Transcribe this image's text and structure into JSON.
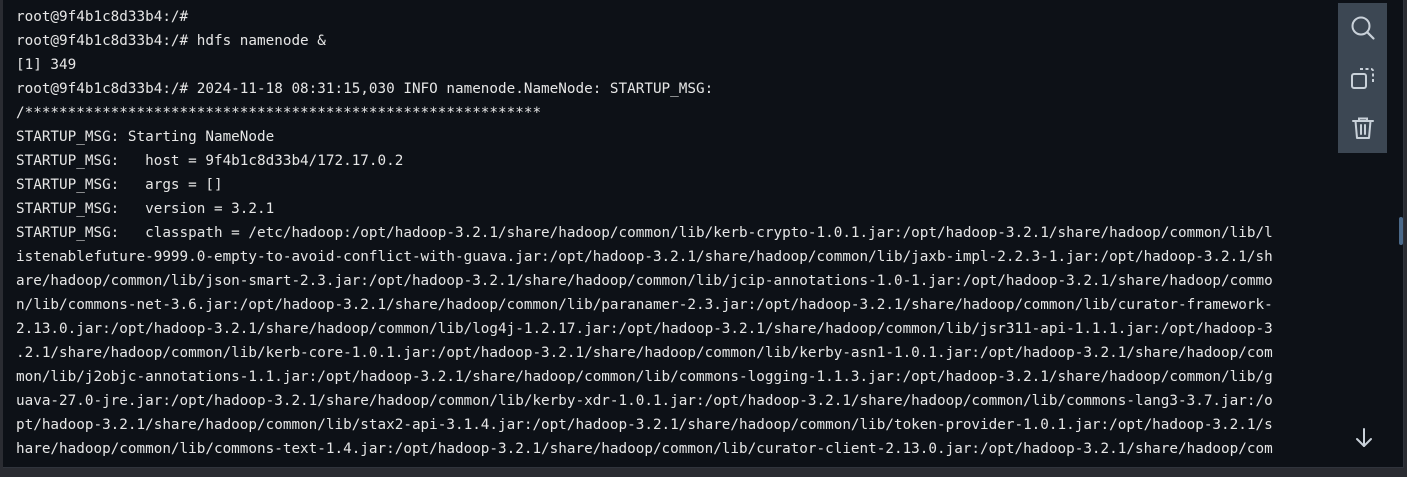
{
  "terminal": {
    "lines": [
      "root@9f4b1c8d33b4:/#",
      "root@9f4b1c8d33b4:/# hdfs namenode &",
      "[1] 349",
      "root@9f4b1c8d33b4:/# 2024-11-18 08:31:15,030 INFO namenode.NameNode: STARTUP_MSG:",
      "/************************************************************",
      "STARTUP_MSG: Starting NameNode",
      "STARTUP_MSG:   host = 9f4b1c8d33b4/172.17.0.2",
      "STARTUP_MSG:   args = []",
      "STARTUP_MSG:   version = 3.2.1",
      "STARTUP_MSG:   classpath = /etc/hadoop:/opt/hadoop-3.2.1/share/hadoop/common/lib/kerb-crypto-1.0.1.jar:/opt/hadoop-3.2.1/share/hadoop/common/lib/l",
      "istenablefuture-9999.0-empty-to-avoid-conflict-with-guava.jar:/opt/hadoop-3.2.1/share/hadoop/common/lib/jaxb-impl-2.2.3-1.jar:/opt/hadoop-3.2.1/sh",
      "are/hadoop/common/lib/json-smart-2.3.jar:/opt/hadoop-3.2.1/share/hadoop/common/lib/jcip-annotations-1.0-1.jar:/opt/hadoop-3.2.1/share/hadoop/commo",
      "n/lib/commons-net-3.6.jar:/opt/hadoop-3.2.1/share/hadoop/common/lib/paranamer-2.3.jar:/opt/hadoop-3.2.1/share/hadoop/common/lib/curator-framework-",
      "2.13.0.jar:/opt/hadoop-3.2.1/share/hadoop/common/lib/log4j-1.2.17.jar:/opt/hadoop-3.2.1/share/hadoop/common/lib/jsr311-api-1.1.1.jar:/opt/hadoop-3",
      ".2.1/share/hadoop/common/lib/kerb-core-1.0.1.jar:/opt/hadoop-3.2.1/share/hadoop/common/lib/kerby-asn1-1.0.1.jar:/opt/hadoop-3.2.1/share/hadoop/com",
      "mon/lib/j2objc-annotations-1.1.jar:/opt/hadoop-3.2.1/share/hadoop/common/lib/commons-logging-1.1.3.jar:/opt/hadoop-3.2.1/share/hadoop/common/lib/g",
      "uava-27.0-jre.jar:/opt/hadoop-3.2.1/share/hadoop/common/lib/kerby-xdr-1.0.1.jar:/opt/hadoop-3.2.1/share/hadoop/common/lib/commons-lang3-3.7.jar:/o",
      "pt/hadoop-3.2.1/share/hadoop/common/lib/stax2-api-3.1.4.jar:/opt/hadoop-3.2.1/share/hadoop/common/lib/token-provider-1.0.1.jar:/opt/hadoop-3.2.1/s",
      "hare/hadoop/common/lib/commons-text-1.4.jar:/opt/hadoop-3.2.1/share/hadoop/common/lib/curator-client-2.13.0.jar:/opt/hadoop-3.2.1/share/hadoop/com"
    ]
  },
  "toolbar": {
    "buttons": [
      {
        "icon": "search-icon"
      },
      {
        "icon": "copy-icon"
      },
      {
        "icon": "trash-icon"
      }
    ]
  },
  "scroll_button": {
    "icon": "arrow-down-icon"
  },
  "colors": {
    "terminal_bg": "#0d1117",
    "text": "#e6e6e6",
    "toolbar_bg": "#3c4753",
    "icon": "#c9d1d9"
  }
}
